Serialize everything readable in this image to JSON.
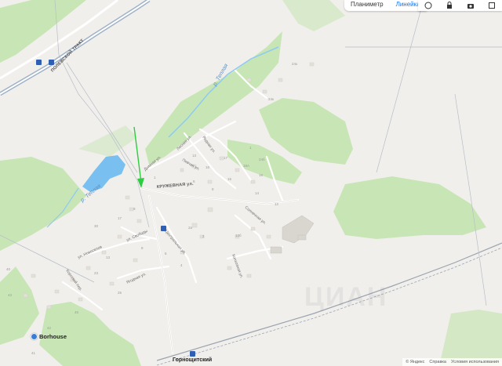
{
  "toolbar": {
    "planimeter_label": "Планиметр",
    "ruler_label": "Линейка",
    "icons": [
      "circle-icon",
      "lock-icon",
      "camera-icon",
      "square-icon"
    ]
  },
  "map": {
    "streets": {
      "polevskoy_trakt": "ПОЛЕВСКОЙ ТРАКТ",
      "kruzhevnaya": "КРУЖЕВНАЯ ул.",
      "dymnaya": "Дымная ул.",
      "lesnaya": "Лесная ул.",
      "pevchaya": "Певчая ул.",
      "rodnaya": "Родная ул.",
      "svobody": "ул. Свободы",
      "novosyolov": "ул. Новоселов",
      "tsentralnaya": "Центральная ул.",
      "korotkiy": "Короткий пер.",
      "yagodnaya": "Ягодная ул.",
      "solnechnaya": "Солнечная ул.",
      "kolkhoznaya": "Колхозная ул."
    },
    "rivers": {
      "teplaya_top": "р. Теплая",
      "teplaya_lake": "р. Теплая"
    },
    "house_numbers": [
      "24к",
      "24к",
      "24б",
      "17",
      "13",
      "1",
      "18А",
      "18",
      "16",
      "15",
      "8",
      "14",
      "12",
      "6",
      "30",
      "12б",
      "2",
      "2а",
      "1",
      "9",
      "17",
      "8",
      "5",
      "13",
      "4",
      "23",
      "25",
      "40",
      "43",
      "41",
      "42",
      "46"
    ],
    "poi": {
      "borhouse": "Borhouse"
    },
    "station": "Горнощитский",
    "watermark": "ЦИАН"
  },
  "footer": {
    "yandex": "© Яндекс",
    "help": "Справка",
    "terms": "Условия использования"
  },
  "colors": {
    "background": "#f1efec",
    "forest": "#c8e6b5",
    "water": "#79c0f0",
    "road": "#ffffff",
    "arrow": "#2ecc40",
    "railway": "#9aa4b0"
  }
}
